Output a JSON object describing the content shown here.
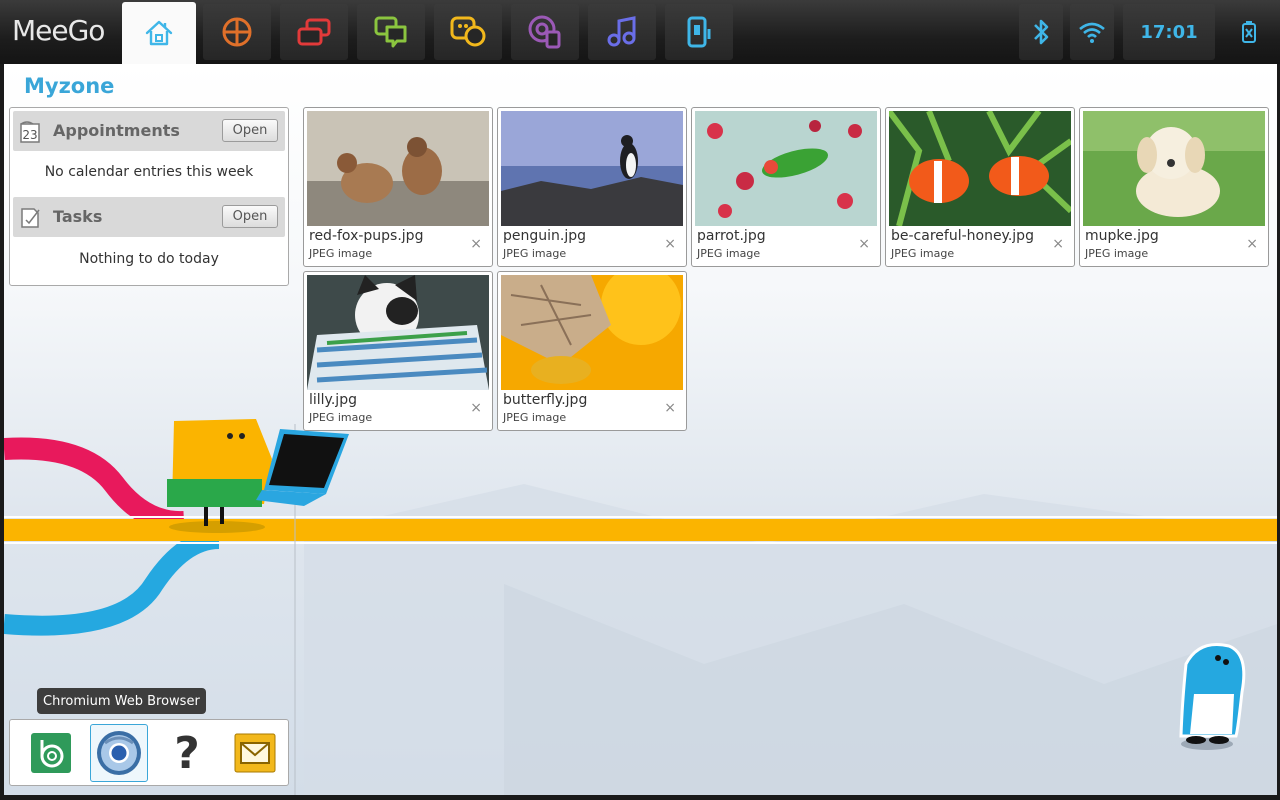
{
  "toolbar": {
    "brand": "MeeGo",
    "zones": [
      {
        "name": "myzone",
        "icon": "home-icon",
        "color": "#3fb6e8",
        "active": true
      },
      {
        "name": "applications",
        "icon": "apps-grid-icon",
        "color": "#e0702a"
      },
      {
        "name": "zones",
        "icon": "windows-icon",
        "color": "#e23a3a"
      },
      {
        "name": "status",
        "icon": "chat-bubbles-icon",
        "color": "#8bc53f"
      },
      {
        "name": "people",
        "icon": "people-icon",
        "color": "#f2b81c"
      },
      {
        "name": "internet",
        "icon": "internet-icon",
        "color": "#9b59b6"
      },
      {
        "name": "media",
        "icon": "music-note-icon",
        "color": "#6a6ee8"
      },
      {
        "name": "devices",
        "icon": "device-icon",
        "color": "#3fb6e8"
      }
    ],
    "status": {
      "bluetooth_icon": "bluetooth-icon",
      "wifi_icon": "wifi-icon",
      "clock": "17:01",
      "battery_icon": "battery-icon",
      "accent": "#3fb6e8"
    }
  },
  "main": {
    "title": "Myzone",
    "appointments": {
      "title": "Appointments",
      "icon_text": "23",
      "open_label": "Open",
      "message": "No calendar entries this week"
    },
    "tasks": {
      "title": "Tasks",
      "open_label": "Open",
      "message": "Nothing to do today"
    },
    "files": [
      {
        "name": "red-fox-pups.jpg",
        "type": "JPEG image",
        "close": "×"
      },
      {
        "name": "penguin.jpg",
        "type": "JPEG image",
        "close": "×"
      },
      {
        "name": "parrot.jpg",
        "type": "JPEG image",
        "close": "×"
      },
      {
        "name": "be-careful-honey.jpg",
        "type": "JPEG image",
        "close": "×"
      },
      {
        "name": "mupke.jpg",
        "type": "JPEG image",
        "close": "×"
      },
      {
        "name": "lilly.jpg",
        "type": "JPEG image",
        "close": "×"
      },
      {
        "name": "butterfly.jpg",
        "type": "JPEG image",
        "close": "×"
      }
    ],
    "launcher": {
      "tooltip": "Chromium Web Browser",
      "apps": [
        {
          "name": "app-b",
          "icon": "b-app-icon"
        },
        {
          "name": "chromium",
          "icon": "chromium-icon",
          "selected": true
        },
        {
          "name": "help",
          "icon": "question-icon",
          "glyph": "?"
        },
        {
          "name": "email",
          "icon": "mail-icon"
        }
      ]
    }
  }
}
